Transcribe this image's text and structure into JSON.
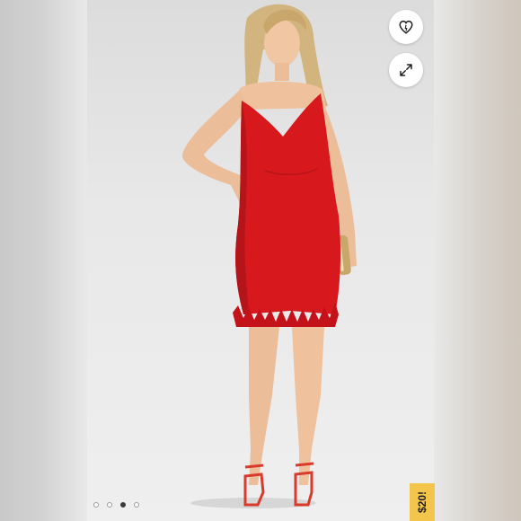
{
  "listing": {
    "price_badge": "$20!",
    "carousel": {
      "total": 4,
      "active_index": 2
    }
  },
  "controls": {
    "like_icon": "heart-icon",
    "expand_icon": "expand-arrows-icon"
  },
  "colors": {
    "dress": "#d7191d",
    "price_badge_bg": "#f3c64b",
    "background": "#ececec"
  }
}
